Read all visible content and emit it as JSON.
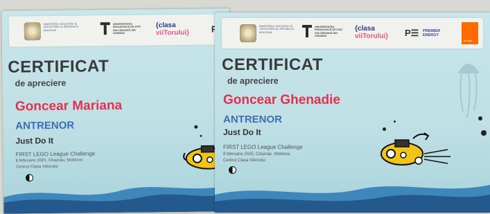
{
  "certificate_left": {
    "header": {
      "ministry": "MINISTERUL EDUCAȚIEI ȘI CERCETĂRII AL REPUBLICII MOLDOVA",
      "university": "UNIVERSITATEA PEDAGOGICĂ DE STAT ION CREANGĂ DIN CHIȘINĂU",
      "clasa_line1": "{clasa",
      "clasa_line2": "viiTorului}",
      "premier_mark": "P"
    },
    "title": "CERTIFICAT",
    "subtitle": "de apreciere",
    "name": "Goncear Mariana",
    "role": "ANTRENOR",
    "team": "Just Do It",
    "event": "FIRST LEGO League Challenge",
    "date": "8 februarie 2025, Chișinău, Moldova",
    "venue": "Centrul Clasa Viitorului"
  },
  "certificate_right": {
    "header": {
      "ministry": "MINISTERUL EDUCAȚIEI ȘI CERCETĂRII AL REPUBLICII MOLDOVA",
      "university": "UNIVERSITATEA PEDAGOGICĂ DE STAT ION CREANGĂ DIN CHIȘINĂU",
      "clasa_line1": "{clasa",
      "clasa_line2": "viiTorului}",
      "premier_mark": "P☰",
      "premier_text_1": "PREMIER",
      "premier_text_2": "ENERGY",
      "orange_label": "orange"
    },
    "title": "CERTIFICAT",
    "subtitle": "de apreciere",
    "name": "Goncear Ghenadie",
    "role": "ANTRENOR",
    "team": "Just Do It",
    "event": "FIRST LEGO League Challenge",
    "date": "8 februarie 2025, Chișinău, Moldova",
    "venue": "Centrul Clasa Viitorului"
  },
  "colors": {
    "name": "#e0314f",
    "role": "#3c6fb3",
    "wave": "#2f6ea6",
    "submarine": "#f0c419"
  }
}
